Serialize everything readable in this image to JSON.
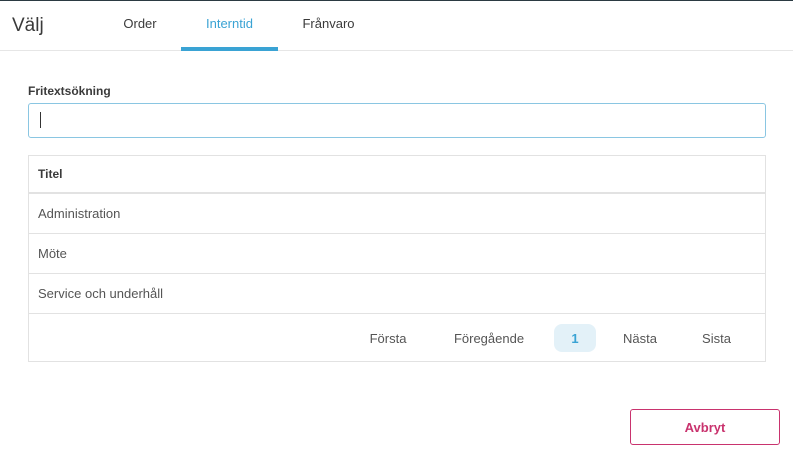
{
  "header": {
    "title": "Välj",
    "tabs": [
      {
        "label": "Order",
        "active": false
      },
      {
        "label": "Interntid",
        "active": true
      },
      {
        "label": "Frånvaro",
        "active": false
      }
    ]
  },
  "search": {
    "label": "Fritextsökning",
    "value": ""
  },
  "table": {
    "header": "Titel",
    "rows": [
      {
        "title": "Administration"
      },
      {
        "title": "Möte"
      },
      {
        "title": "Service och underhåll"
      }
    ]
  },
  "pagination": {
    "first": "Första",
    "previous": "Föregående",
    "current": "1",
    "next": "Nästa",
    "last": "Sista"
  },
  "footer": {
    "cancel_label": "Avbryt"
  },
  "colors": {
    "accent": "#3aa3d4",
    "cancel": "#c9336e"
  }
}
